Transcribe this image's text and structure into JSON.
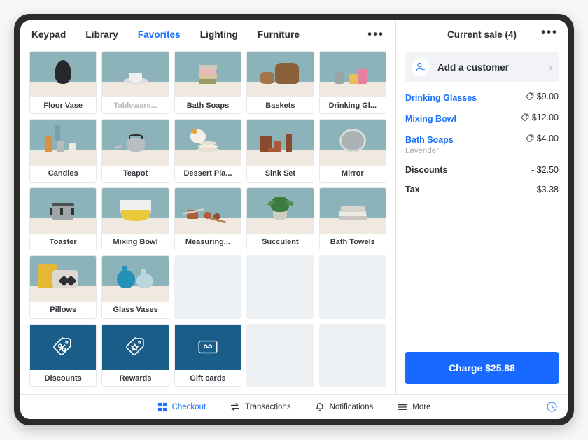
{
  "theme": {
    "accent_blue": "#1a73ff",
    "charge_blue": "#1769ff",
    "action_tile_blue": "#1a5d88",
    "thumb_wall": "#8cb2ba",
    "thumb_shelf": "#efe9df",
    "muted_text": "#b7bcc1"
  },
  "catalog": {
    "tabs": [
      {
        "label": "Keypad",
        "active": false
      },
      {
        "label": "Library",
        "active": false
      },
      {
        "label": "Favorites",
        "active": true
      },
      {
        "label": "Lighting",
        "active": false
      },
      {
        "label": "Furniture",
        "active": false
      }
    ],
    "overflow_label": "•••",
    "tiles": [
      {
        "label": "Floor Vase",
        "kind": "product",
        "art": "vase-dark",
        "muted": false
      },
      {
        "label": "Tableware...",
        "kind": "product",
        "art": "tableware",
        "muted": true
      },
      {
        "label": "Bath Soaps",
        "kind": "product",
        "art": "soap-stack",
        "muted": false
      },
      {
        "label": "Baskets",
        "kind": "product",
        "art": "baskets",
        "muted": false
      },
      {
        "label": "Drinking Gl...",
        "kind": "product",
        "art": "glasses",
        "muted": false
      },
      {
        "label": "Candles",
        "kind": "product",
        "art": "candles",
        "muted": false
      },
      {
        "label": "Teapot",
        "kind": "product",
        "art": "teapot",
        "muted": false
      },
      {
        "label": "Dessert Pla...",
        "kind": "product",
        "art": "plates",
        "muted": false
      },
      {
        "label": "Sink Set",
        "kind": "product",
        "art": "sink-set",
        "muted": false
      },
      {
        "label": "Mirror",
        "kind": "product",
        "art": "mirror",
        "muted": false
      },
      {
        "label": "Toaster",
        "kind": "product",
        "art": "toaster",
        "muted": false
      },
      {
        "label": "Mixing Bowl",
        "kind": "product",
        "art": "mixing-bowl",
        "muted": false
      },
      {
        "label": "Measuring...",
        "kind": "product",
        "art": "measuring",
        "muted": false
      },
      {
        "label": "Succulent",
        "kind": "product",
        "art": "succulent",
        "muted": false
      },
      {
        "label": "Bath Towels",
        "kind": "product",
        "art": "towels",
        "muted": false
      },
      {
        "label": "Pillows",
        "kind": "product",
        "art": "pillows",
        "muted": false
      },
      {
        "label": "Glass Vases",
        "kind": "product",
        "art": "glass-vases",
        "muted": false
      },
      {
        "label": "",
        "kind": "empty",
        "art": "",
        "muted": false
      },
      {
        "label": "",
        "kind": "empty",
        "art": "",
        "muted": false
      },
      {
        "label": "",
        "kind": "empty",
        "art": "",
        "muted": false
      },
      {
        "label": "Discounts",
        "kind": "action",
        "art": "percent-tag-icon",
        "muted": false
      },
      {
        "label": "Rewards",
        "kind": "action",
        "art": "star-tag-icon",
        "muted": false
      },
      {
        "label": "Gift cards",
        "kind": "action",
        "art": "gift-card-icon",
        "muted": false
      },
      {
        "label": "",
        "kind": "empty",
        "art": "",
        "muted": false
      },
      {
        "label": "",
        "kind": "empty",
        "art": "",
        "muted": false
      }
    ]
  },
  "sale": {
    "title": "Current sale (4)",
    "overflow_label": "•••",
    "add_customer": {
      "label": "Add a customer",
      "icon": "person-plus-icon",
      "chevron": "›"
    },
    "line_items": [
      {
        "name": "Drinking Glasses",
        "sub": "",
        "amount": "$9.00",
        "has_tag": true,
        "style": "link"
      },
      {
        "name": "Mixing Bowl",
        "sub": "",
        "amount": "$12.00",
        "has_tag": true,
        "style": "link"
      },
      {
        "name": "Bath Soaps",
        "sub": "Lavender",
        "amount": "$4.00",
        "has_tag": true,
        "style": "link"
      },
      {
        "name": "Discounts",
        "sub": "",
        "amount": "- $2.50",
        "has_tag": false,
        "style": "plain"
      },
      {
        "name": "Tax",
        "sub": "",
        "amount": "$3.38",
        "has_tag": false,
        "style": "plain"
      }
    ],
    "charge_button_label": "Charge $25.88"
  },
  "bottom_nav": {
    "items": [
      {
        "label": "Checkout",
        "icon": "grid-icon",
        "active": true
      },
      {
        "label": "Transactions",
        "icon": "transfer-arrows-icon",
        "active": false
      },
      {
        "label": "Notifications",
        "icon": "bell-icon",
        "active": false
      },
      {
        "label": "More",
        "icon": "hamburger-icon",
        "active": false
      }
    ],
    "clock_icon": "clock-icon"
  }
}
